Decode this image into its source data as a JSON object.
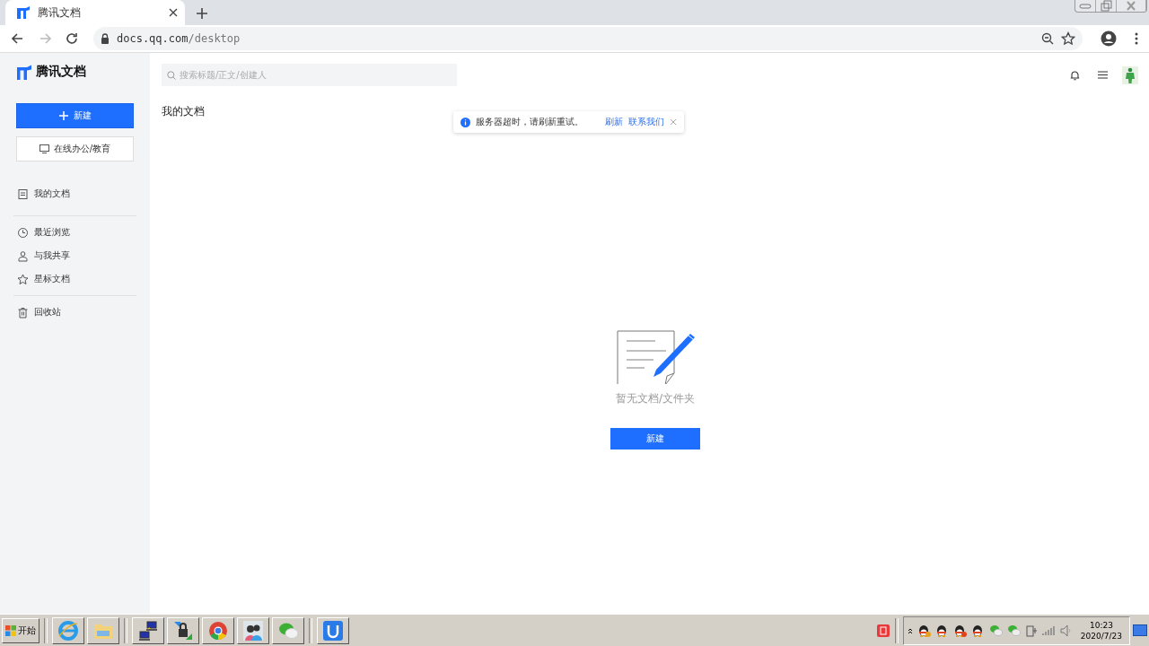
{
  "browser": {
    "tab": {
      "title": "腾讯文档"
    },
    "url": {
      "host": "docs.qq.com",
      "path": "/desktop"
    }
  },
  "sidebar": {
    "logo": "腾讯文档",
    "new_button": "新建",
    "online_button": "在线办公/教育",
    "nav_groups": [
      [
        "我的文档"
      ],
      [
        "最近浏览",
        "与我共享",
        "星标文档"
      ],
      [
        "回收站"
      ]
    ]
  },
  "main": {
    "search": {
      "placeholder": "搜索标题/正文/创建人"
    },
    "heading": "我的文档",
    "toast": {
      "message": "服务器超时，请刷新重试。",
      "actions": [
        "刷新",
        "联系我们"
      ]
    },
    "empty": {
      "text": "暂无文档/文件夹",
      "button": "新建"
    }
  },
  "taskbar": {
    "start": "开始",
    "time": "10:23",
    "date": "2020/7/23"
  }
}
